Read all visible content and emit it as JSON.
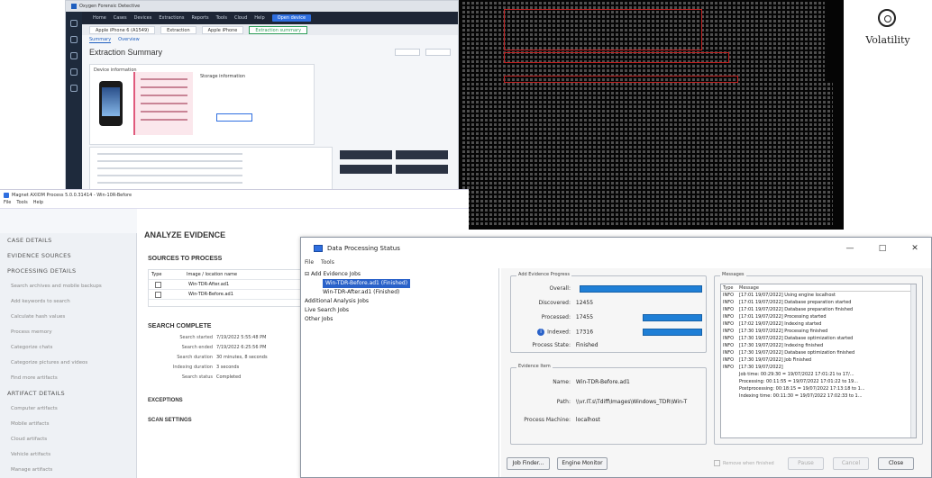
{
  "mobile_window": {
    "title": "Oxygen Forensic Detective",
    "menu": [
      "Home",
      "Cases",
      "Devices",
      "Extractions",
      "Reports",
      "Tools",
      "Cloud",
      "Help"
    ],
    "menu_highlight": "Open device",
    "tabs": [
      "Apple iPhone 6 (A1549)",
      "Extraction",
      "Apple iPhone",
      "Extraction summary"
    ],
    "subtabs": [
      "Summary",
      "Overview"
    ],
    "heading": "Extraction Summary",
    "card_label": "Device information",
    "card_right": "Storage information"
  },
  "volatility": {
    "brand": "Volatility"
  },
  "axiom": {
    "title": "Magnet AXIOM Process 5.0.0.31414 - Win-10R-Before",
    "menu": [
      "File",
      "Tools",
      "Help"
    ],
    "nav": [
      {
        "label": "CASE DETAILS",
        "type": "hdr"
      },
      {
        "label": "EVIDENCE SOURCES",
        "type": "hdr"
      },
      {
        "label": "PROCESSING DETAILS",
        "type": "hdr"
      },
      {
        "label": "Search archives and mobile backups",
        "type": "sub"
      },
      {
        "label": "Add keywords to search",
        "type": "sub"
      },
      {
        "label": "Calculate hash values",
        "type": "sub"
      },
      {
        "label": "Process memory",
        "type": "sub"
      },
      {
        "label": "Categorize chats",
        "type": "sub"
      },
      {
        "label": "Categorize pictures and videos",
        "type": "sub"
      },
      {
        "label": "Find more artifacts",
        "type": "sub"
      },
      {
        "label": "ARTIFACT DETAILS",
        "type": "hdr"
      },
      {
        "label": "Computer artifacts",
        "type": "sub"
      },
      {
        "label": "Mobile artifacts",
        "type": "sub"
      },
      {
        "label": "Cloud artifacts",
        "type": "sub"
      },
      {
        "label": "Vehicle artifacts",
        "type": "sub"
      },
      {
        "label": "Manage artifacts",
        "type": "sub"
      },
      {
        "label": "ANALYZE EVIDENCE",
        "type": "cur"
      }
    ],
    "heading": "ANALYZE EVIDENCE",
    "sources_heading": "SOURCES TO PROCESS",
    "sources_cols": [
      "Type",
      "Image / location name"
    ],
    "sources": [
      "Win-TDR-After.ad1",
      "Win-TDR-Before.ad1"
    ],
    "search_heading": "SEARCH COMPLETE",
    "summary": [
      {
        "k": "Search started",
        "v": "7/19/2022 5:55:48 PM"
      },
      {
        "k": "Search ended",
        "v": "7/19/2022 6:25:56 PM"
      },
      {
        "k": "Search duration",
        "v": "30 minutes, 8 seconds"
      },
      {
        "k": "Indexing duration",
        "v": "3 seconds"
      },
      {
        "k": "Search status",
        "v": "Completed"
      }
    ],
    "exceptions": "EXCEPTIONS",
    "scan_settings": "SCAN SETTINGS"
  },
  "dps": {
    "title": "Data Processing Status",
    "controls": [
      "—",
      "□",
      "✕"
    ],
    "menu": [
      "File",
      "Tools"
    ],
    "tree": [
      {
        "label": "Add Evidence Jobs",
        "level": 0
      },
      {
        "label": "Win-TDR-Before.ad1 (Finished)",
        "level": 1,
        "selected": true
      },
      {
        "label": "Win-TDR-After.ad1 (Finished)",
        "level": 1
      },
      {
        "label": "Additional Analysis Jobs",
        "level": 0
      },
      {
        "label": "Live Search Jobs",
        "level": 0
      },
      {
        "label": "Other Jobs",
        "level": 0
      }
    ],
    "progress_legend": "Add Evidence Progress",
    "overall_label": "Overall:",
    "overall_pct": 100,
    "discovered_label": "Discovered:",
    "discovered_value": "12455",
    "processed_label": "Processed:",
    "processed_value": "17455",
    "processed_pct": 100,
    "indexed_label": "Indexed:",
    "indexed_value": "17316",
    "indexed_pct": 100,
    "status_label": "Process State:",
    "status_value": "Finished",
    "evidence_legend": "Evidence Item",
    "name_label": "Name:",
    "name_value": "Win-TDR-Before.ad1",
    "path_label": "Path:",
    "path_value": "\\\\vr.IT.s\\Tdiff\\Images\\Windows_TDR\\Win-T",
    "machine_label": "Process Machine:",
    "machine_value": "localhost",
    "messages_legend": "Messages",
    "msg_cols": [
      "Type",
      "Message"
    ],
    "messages": [
      {
        "t": "INFO",
        "m": "[17:01 19/07/2022] Using engine localhost"
      },
      {
        "t": "INFO",
        "m": "[17:01 19/07/2022] Database preparation started"
      },
      {
        "t": "INFO",
        "m": "[17:01 19/07/2022] Database preparation finished"
      },
      {
        "t": "INFO",
        "m": "[17:01 19/07/2022] Processing started"
      },
      {
        "t": "INFO",
        "m": "[17:02 19/07/2022] Indexing started"
      },
      {
        "t": "INFO",
        "m": "[17:30 19/07/2022] Processing finished"
      },
      {
        "t": "INFO",
        "m": "[17:30 19/07/2022] Database optimization started"
      },
      {
        "t": "INFO",
        "m": "[17:30 19/07/2022] Indexing finished"
      },
      {
        "t": "INFO",
        "m": "[17:30 19/07/2022] Database optimization finished"
      },
      {
        "t": "INFO",
        "m": "[17:30 19/07/2022] Job Finished"
      },
      {
        "t": "INFO",
        "m": "[17:30 19/07/2022]"
      },
      {
        "t": "",
        "m": "Job time: 00:29:30 = 19/07/2022 17:01:21 to 17/..."
      },
      {
        "t": "",
        "m": "Processing: 00:11:55 = 19/07/2022 17:01:22 to 19..."
      },
      {
        "t": "",
        "m": "Postprocessing: 00:18:15 = 19/07/2022 17:13:18 to 1..."
      },
      {
        "t": "",
        "m": "Indexing time: 00:11:30 = 19/07/2022 17:02:33 to 1..."
      }
    ],
    "btn_job_finder": "Job Finder...",
    "btn_engine_monitor": "Engine Monitor",
    "chk_remove": "Remove when finished",
    "btn_pause": "Pause",
    "btn_cancel": "Cancel",
    "btn_close": "Close"
  }
}
